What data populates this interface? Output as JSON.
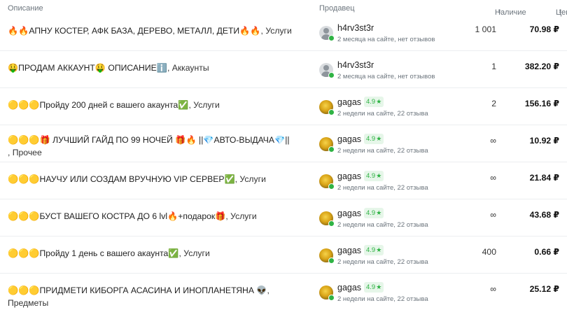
{
  "header": {
    "description": "Описание",
    "seller": "Продавец",
    "stock": "Наличие",
    "price": "Цена",
    "sort_icon": "⇕"
  },
  "rows": [
    {
      "description": "🔥🔥АПНУ КОСТЕР, АФК БАЗА, ДЕРЕВО, МЕТАЛЛ, ДЕТИ🔥🔥",
      "category": ", Услуги",
      "seller": {
        "name": "h4rv3st3r",
        "avatar": "default-user-icon",
        "rating": "",
        "meta": "2 месяца на сайте, нет отзывов"
      },
      "stock": "1 001",
      "price": "70.98 ₽"
    },
    {
      "description": "🤑ПРОДАМ АККАУНТ🤑 ОПИСАНИЕℹ️",
      "category": ", Аккаунты",
      "seller": {
        "name": "h4rv3st3r",
        "avatar": "default-user-icon",
        "rating": "",
        "meta": "2 месяца на сайте, нет отзывов"
      },
      "stock": "1",
      "price": "382.20 ₽"
    },
    {
      "description": "🟡🟡🟡Пройду 200 дней с вашего акаунта✅",
      "category": ", Услуги",
      "seller": {
        "name": "gagas",
        "avatar": "gold-avatar",
        "rating": "4.9",
        "meta": "2 недели на сайте, 22 отзыва"
      },
      "stock": "2",
      "price": "156.16 ₽"
    },
    {
      "description": "🟡🟡🟡🎁 ЛУЧШИЙ ГАЙД ПО 99 НОЧЕЙ 🎁🔥 ||💎АВТО-ВЫДАЧА💎||",
      "category": ", Прочее",
      "seller": {
        "name": "gagas",
        "avatar": "gold-avatar",
        "rating": "4.9",
        "meta": "2 недели на сайте, 22 отзыва"
      },
      "stock": "∞",
      "price": "10.92 ₽"
    },
    {
      "description": "🟡🟡🟡НАУЧУ ИЛИ СОЗДАМ ВРУЧНУЮ VIP СЕРВЕР✅",
      "category": ", Услуги",
      "seller": {
        "name": "gagas",
        "avatar": "gold-avatar",
        "rating": "4.9",
        "meta": "2 недели на сайте, 22 отзыва"
      },
      "stock": "∞",
      "price": "21.84 ₽"
    },
    {
      "description": "🟡🟡🟡БУСТ ВАШЕГО КОСТРА ДО 6 lvl🔥+подарок🎁",
      "category": ", Услуги",
      "seller": {
        "name": "gagas",
        "avatar": "gold-avatar",
        "rating": "4.9",
        "meta": "2 недели на сайте, 22 отзыва"
      },
      "stock": "∞",
      "price": "43.68 ₽"
    },
    {
      "description": "🟡🟡🟡Пройду 1 день с вашего акаунта✅",
      "category": ", Услуги",
      "seller": {
        "name": "gagas",
        "avatar": "gold-avatar",
        "rating": "4.9",
        "meta": "2 недели на сайте, 22 отзыва"
      },
      "stock": "400",
      "price": "0.66 ₽"
    },
    {
      "description": "🟡🟡🟡ПРИДМЕТИ КИБОРГА АСАСИНА И ИНОПЛАНЕТЯНА 👽",
      "category": ", Предметы",
      "seller": {
        "name": "gagas",
        "avatar": "gold-avatar",
        "rating": "4.9",
        "meta": "2 недели на сайте, 22 отзыва"
      },
      "stock": "∞",
      "price": "25.12 ₽"
    }
  ],
  "colors": {
    "online": "#2fb344",
    "rating_bg": "#e6f6e9",
    "divider": "#eceef0",
    "muted": "#6c757d"
  }
}
